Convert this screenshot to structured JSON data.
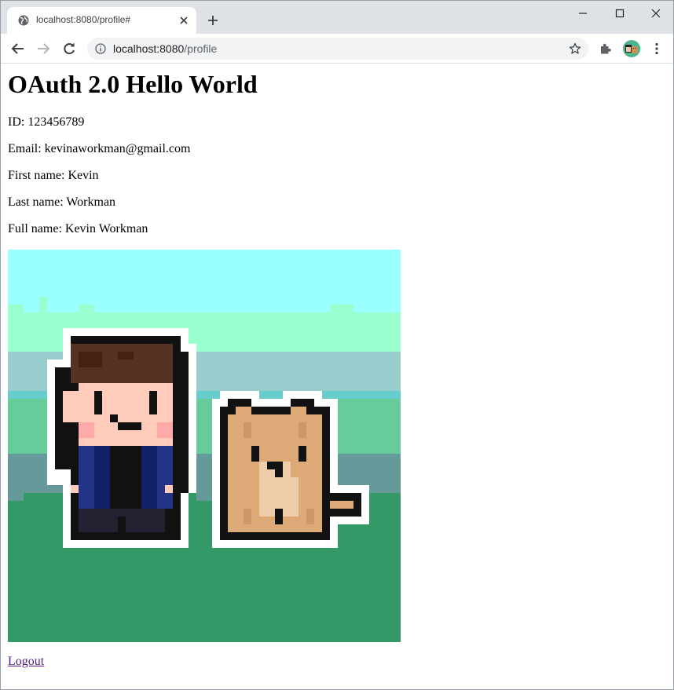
{
  "browser": {
    "tab_title": "localhost:8080/profile#",
    "url_host": "localhost:8080",
    "url_path": "/profile"
  },
  "page": {
    "heading": "OAuth 2.0 Hello World",
    "id_line": "ID: 123456789",
    "email_line": "Email: kevinaworkman@gmail.com",
    "first_name_line": "First name: Kevin",
    "last_name_line": "Last name: Workman",
    "full_name_line": "Full name: Kevin Workman",
    "logout_label": "Logout"
  },
  "colors": {
    "sky": "#99ffff",
    "hill_light": "#99ffcc",
    "hill_mid": "#66cc99",
    "grass": "#339966",
    "link_visited": "#551a8b"
  }
}
